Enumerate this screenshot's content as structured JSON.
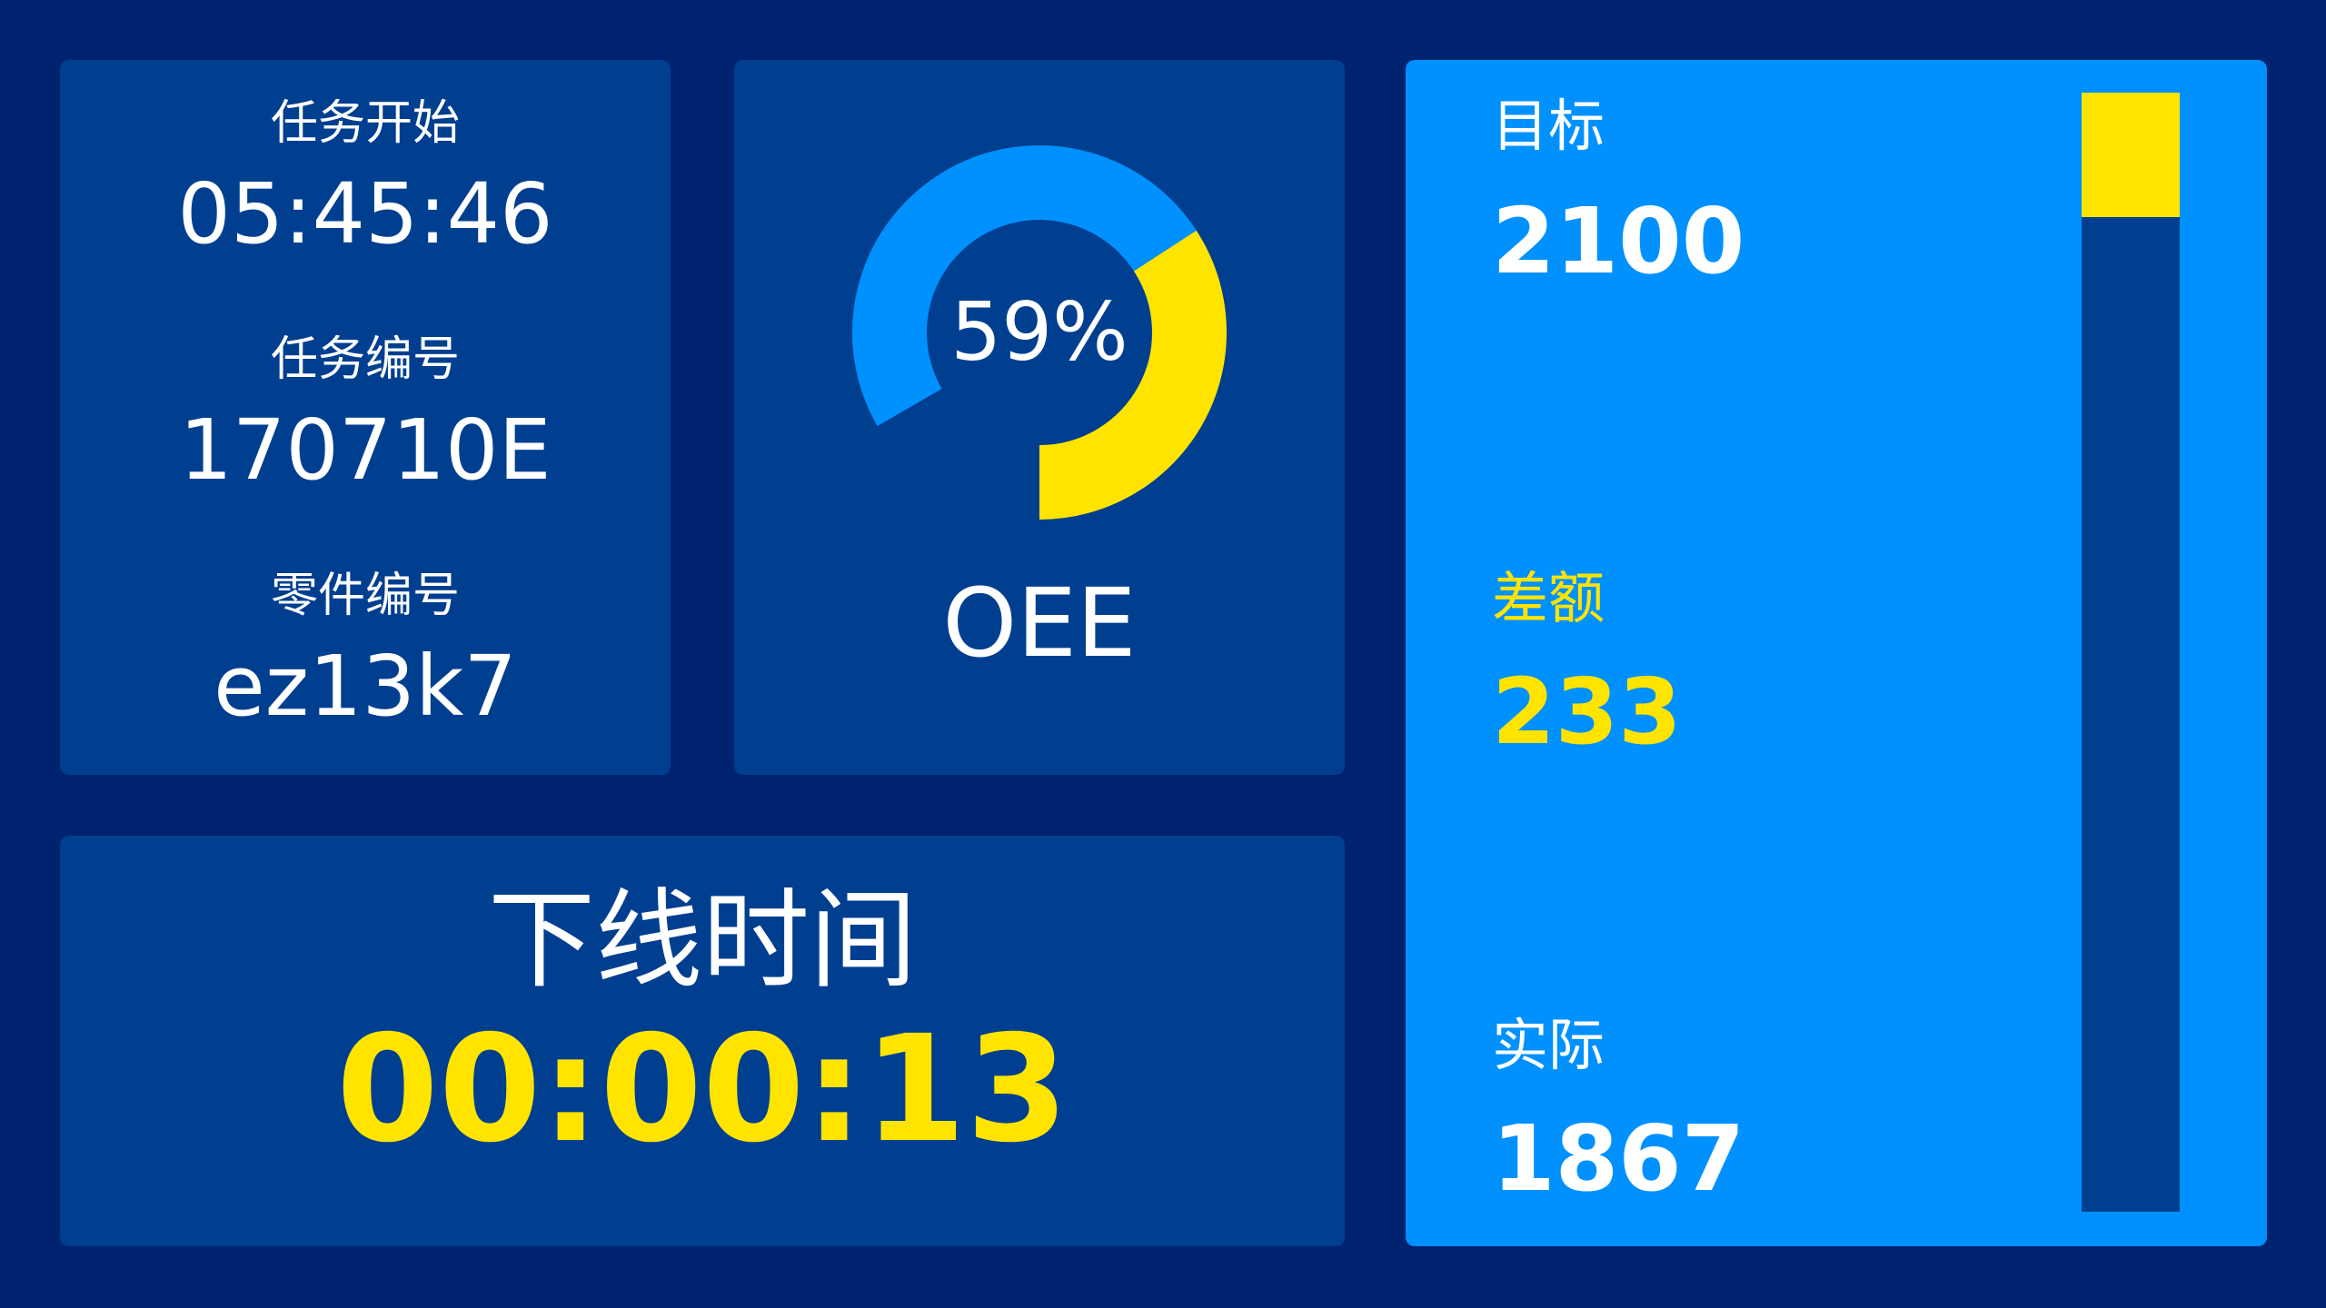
{
  "info": {
    "task_start_label": "任务开始",
    "task_start_value": "05:45:46",
    "task_number_label": "任务编号",
    "task_number_value": "170710E",
    "part_number_label": "零件编号",
    "part_number_value": "ez13k7"
  },
  "oee": {
    "percent": 59,
    "percent_text": "59%",
    "label": "OEE",
    "fill_color": "#ffe400",
    "track_color": "#0091ff"
  },
  "offline": {
    "label": "下线时间",
    "time": "00:00:13"
  },
  "output": {
    "target_label": "目标",
    "target_value": "2100",
    "gap_label": "差额",
    "gap_value": "233",
    "actual_label": "实际",
    "actual_value": "1867",
    "gap_fraction": 0.111
  },
  "colors": {
    "background": "#00236f",
    "panel": "#003f90",
    "accent_blue": "#0091ff",
    "accent_yellow": "#ffe400"
  }
}
